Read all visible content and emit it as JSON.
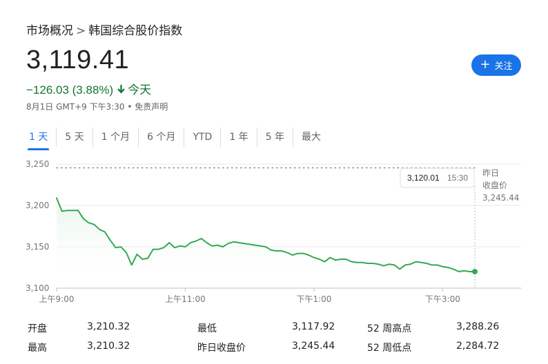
{
  "breadcrumb": {
    "parent": "市场概况",
    "separator": ">",
    "current": "韩国综合股价指数"
  },
  "quote": {
    "price": "3,119.41",
    "change": "−126.03 (3.88%)",
    "period": "今天",
    "meta": "8月1日 GMT+9 下午3:30 • 免责声明"
  },
  "follow_button": {
    "icon": "plus-icon",
    "label": "关注"
  },
  "tabs": [
    {
      "label": "1 天",
      "selected": true
    },
    {
      "label": "5 天"
    },
    {
      "label": "1 个月"
    },
    {
      "label": "6 个月"
    },
    {
      "label": "YTD"
    },
    {
      "label": "1 年"
    },
    {
      "label": "5 年"
    },
    {
      "label": "最大"
    }
  ],
  "chart_data": {
    "type": "line",
    "y_ticks": [
      "3,250",
      "3,200",
      "3,150",
      "3,100"
    ],
    "x_ticks": [
      "上午9:00",
      "上午11:00",
      "下午1:00",
      "下午3:00"
    ],
    "ylim": [
      3100,
      3250
    ],
    "grid": true,
    "line_color": "#34a853",
    "previous_close": {
      "label_line1": "昨日",
      "label_line2": "收盘价",
      "value": "3,245.44",
      "value_num": 3245.44
    },
    "tooltip": {
      "value": "3,120.01",
      "time": "15:30"
    },
    "x": [
      0,
      5,
      10,
      15,
      20,
      25,
      30,
      35,
      40,
      45,
      50,
      55,
      60,
      65,
      70,
      75,
      80,
      85,
      90,
      95,
      100,
      105,
      110,
      115,
      120,
      125,
      130,
      135,
      140,
      145,
      150,
      155,
      160,
      165,
      170,
      175,
      180,
      185,
      190,
      195,
      200,
      205,
      210,
      215,
      220,
      225,
      230,
      235,
      240,
      245,
      250,
      255,
      260,
      265,
      270,
      275,
      280,
      285,
      290,
      295,
      300,
      305,
      310,
      315,
      320,
      325,
      330,
      335,
      340,
      345,
      350,
      355,
      360,
      365,
      370,
      375,
      380,
      385,
      390
    ],
    "values": [
      3209,
      3193,
      3194,
      3194,
      3194,
      3184,
      3179,
      3177,
      3171,
      3168,
      3158,
      3149,
      3150,
      3143,
      3128,
      3141,
      3135,
      3136,
      3147,
      3147,
      3149,
      3155,
      3149,
      3151,
      3150,
      3155,
      3157,
      3160,
      3155,
      3151,
      3152,
      3150,
      3154,
      3156,
      3155,
      3154,
      3153,
      3152,
      3151,
      3150,
      3146,
      3145,
      3145,
      3143,
      3140,
      3142,
      3142,
      3140,
      3137,
      3135,
      3132,
      3137,
      3134,
      3135,
      3135,
      3132,
      3131,
      3131,
      3130,
      3130,
      3129,
      3127,
      3129,
      3128,
      3123,
      3128,
      3129,
      3132,
      3131,
      3130,
      3128,
      3128,
      3126,
      3125,
      3123,
      3120,
      3121,
      3120,
      3120.01
    ]
  },
  "stats": [
    {
      "label": "开盘",
      "value": "3,210.32"
    },
    {
      "label": "最低",
      "value": "3,117.92"
    },
    {
      "label": "52 周高点",
      "value": "3,288.26"
    },
    {
      "label": "最高",
      "value": "3,210.32"
    },
    {
      "label": "昨日收盘价",
      "value": "3,245.44"
    },
    {
      "label": "52 周低点",
      "value": "2,284.72"
    }
  ]
}
